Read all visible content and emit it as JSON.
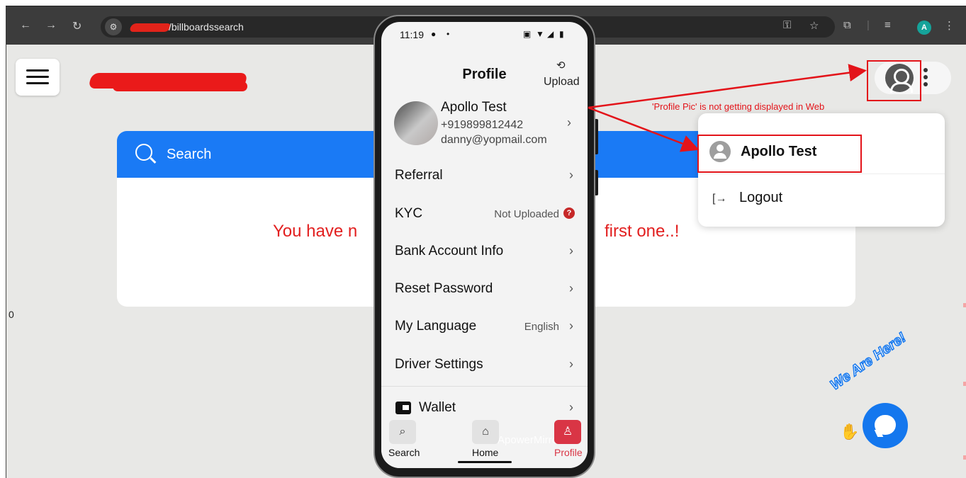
{
  "browser": {
    "url": "/billboardssearch",
    "icons": [
      "back-icon",
      "forward-icon",
      "reload-icon",
      "tune-icon",
      "key-icon",
      "star-icon",
      "extensions-icon",
      "media-queue-icon",
      "more-vert-icon"
    ],
    "profile_initial": "A",
    "colors": {
      "chrome": "#3c3c3c",
      "omnibox": "#282828",
      "profile": "#15a39a"
    }
  },
  "page": {
    "search_label": "Search",
    "empty_left": "You have n",
    "empty_right": "first one..!",
    "stray_text": "0",
    "chat_badge": "We Are Here!",
    "colors": {
      "accent": "#1a7af5",
      "empty_text": "#e21f1f",
      "background": "#e8e8e6"
    }
  },
  "user_menu": {
    "name": "Apollo Test",
    "logout_label": "Logout"
  },
  "annotation": {
    "text": "'Profile Pic' is not getting displayed in Web",
    "color": "#e3141a"
  },
  "phone": {
    "time": "11:19",
    "title": "Profile",
    "upload_label": "Upload",
    "user": {
      "name": "Apollo Test",
      "phone": "+919899812442",
      "email": "danny@yopmail.com"
    },
    "menu": [
      {
        "label": "Referral",
        "value": ""
      },
      {
        "label": "KYC",
        "value": "Not Uploaded"
      },
      {
        "label": "Bank Account Info",
        "value": ""
      },
      {
        "label": "Reset Password",
        "value": ""
      },
      {
        "label": "My Language",
        "value": "English"
      },
      {
        "label": "Driver Settings",
        "value": ""
      },
      {
        "label": "Wallet",
        "value": ""
      }
    ],
    "nav": [
      {
        "label": "Search",
        "icon": "search-list-icon"
      },
      {
        "label": "Home",
        "icon": "home-icon"
      },
      {
        "label": "Profile",
        "icon": "profile-icon",
        "active": true
      }
    ],
    "watermark": "ApowerMirror",
    "colors": {
      "active": "#d93545",
      "warn": "#c62828"
    }
  }
}
